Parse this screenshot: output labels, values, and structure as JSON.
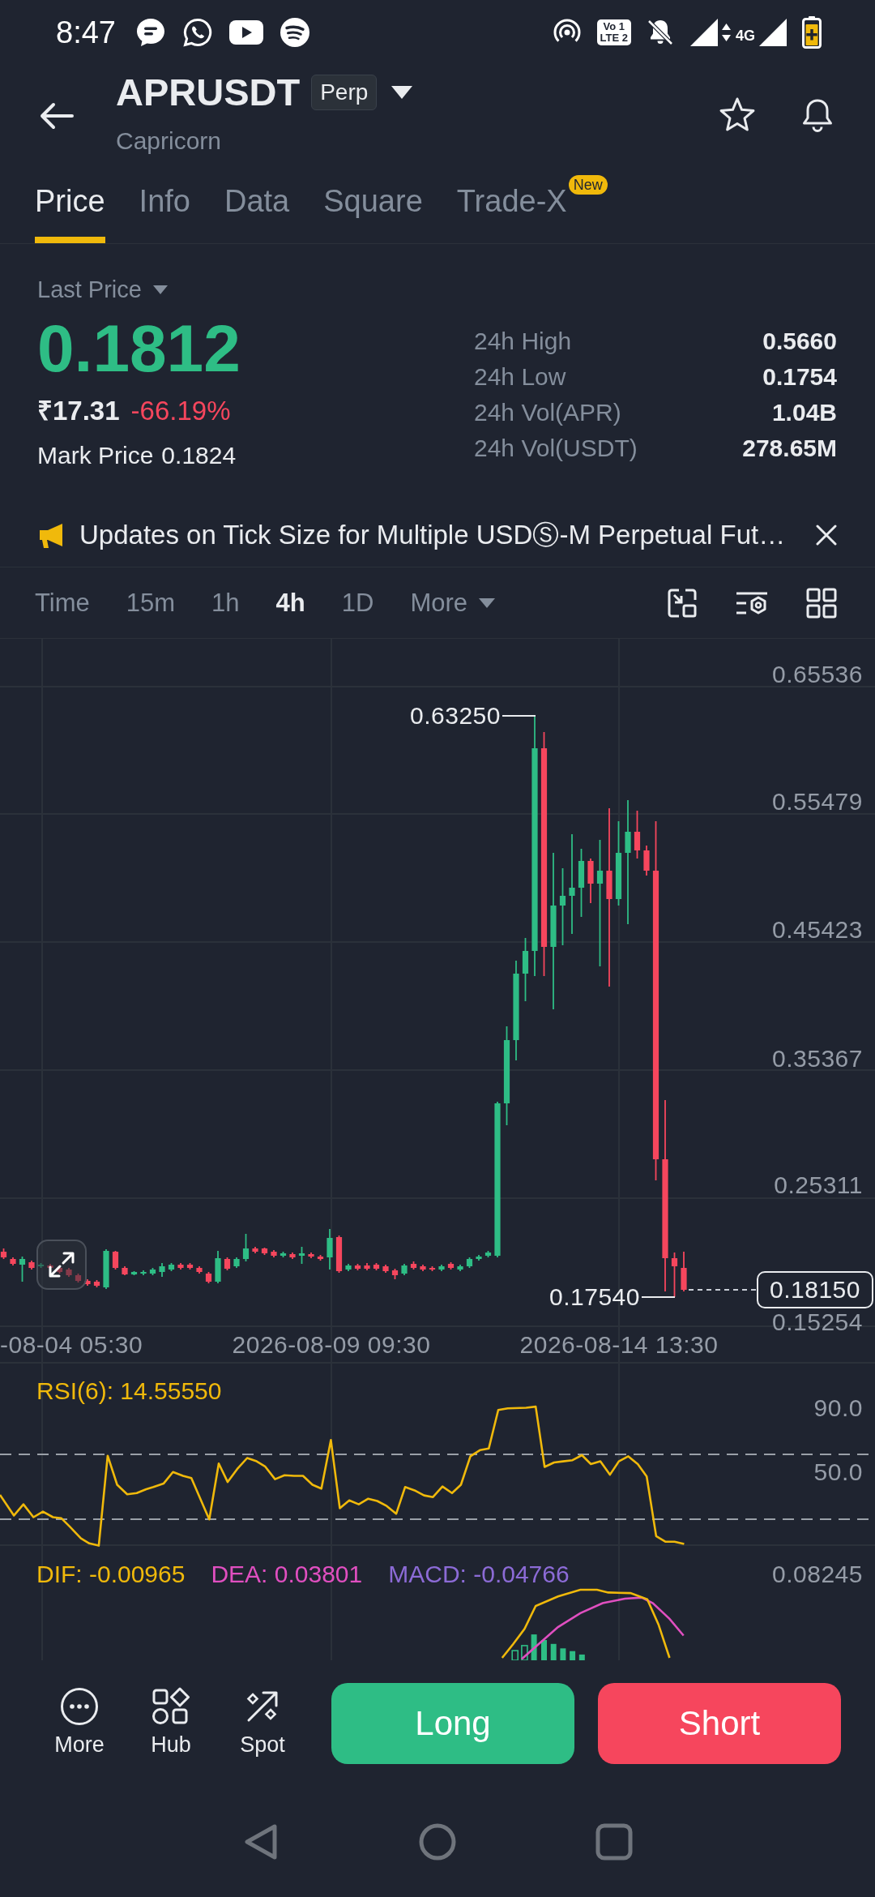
{
  "status_bar": {
    "time": "8:47",
    "volte_badge": [
      "Vo 1",
      "LTE 2"
    ],
    "network_type": "4G"
  },
  "header": {
    "symbol": "APRUSDT",
    "contract_type": "Perp",
    "subtitle": "Capricorn",
    "favorite": false
  },
  "tabs": [
    {
      "label": "Price",
      "selected": true
    },
    {
      "label": "Info",
      "selected": false
    },
    {
      "label": "Data",
      "selected": false
    },
    {
      "label": "Square",
      "selected": false
    },
    {
      "label": "Trade-X",
      "selected": false,
      "badge": "New"
    }
  ],
  "market": {
    "price_type": "Last Price",
    "last_price": "0.1812",
    "last_price_rising": true,
    "fiat_price": "₹17.31",
    "change": "-66.19%",
    "change_rising": false,
    "mark_price_label": "Mark Price",
    "mark_price": "0.1824",
    "stats": [
      {
        "label": "24h High",
        "value": "0.5660"
      },
      {
        "label": "24h Low",
        "value": "0.1754"
      },
      {
        "label": "24h Vol(APR)",
        "value": "1.04B"
      },
      {
        "label": "24h Vol(USDT)",
        "value": "278.65M"
      }
    ]
  },
  "notice": {
    "text": "Updates on Tick Size for Multiple USDⓈ-M Perpetual Fut…"
  },
  "chart_toolbar": {
    "intervals": [
      {
        "label": "Time",
        "kind": "interval",
        "selected": false
      },
      {
        "label": "15m",
        "kind": "interval",
        "selected": false
      },
      {
        "label": "1h",
        "kind": "interval",
        "selected": false
      },
      {
        "label": "4h",
        "kind": "interval",
        "selected": true
      },
      {
        "label": "1D",
        "kind": "interval",
        "selected": false
      },
      {
        "label": "More",
        "kind": "menu",
        "selected": false
      }
    ]
  },
  "chart": {
    "price_axis": [
      "0.65536",
      "0.55479",
      "0.45423",
      "0.35367",
      "0.25311",
      "0.15254"
    ],
    "high_marker": "0.63250",
    "low_marker": "0.17540",
    "current_price": "0.18150",
    "time_axis": [
      "-08-04 05:30",
      "2026-08-09 09:30",
      "2026-08-14 13:30"
    ]
  },
  "rsi": {
    "label": "RSI(6): 14.55550",
    "axis": [
      "90.0",
      "50.0"
    ]
  },
  "macd": {
    "legend": [
      {
        "text": "DIF: -0.00965",
        "color": "#f0b90b"
      },
      {
        "text": "DEA: 0.03801",
        "color": "#e04fc0"
      },
      {
        "text": "MACD: -0.04766",
        "color": "#8c6bd6"
      }
    ],
    "axis": [
      "0.08245"
    ]
  },
  "bottom_bar": {
    "shortcuts": [
      {
        "label": "More",
        "kind": "dots"
      },
      {
        "label": "Hub",
        "kind": "shapes"
      },
      {
        "label": "Spot",
        "kind": "arrow"
      }
    ],
    "actions": [
      {
        "label": "Long",
        "kind": "long"
      },
      {
        "label": "Short",
        "kind": "short"
      }
    ]
  }
}
